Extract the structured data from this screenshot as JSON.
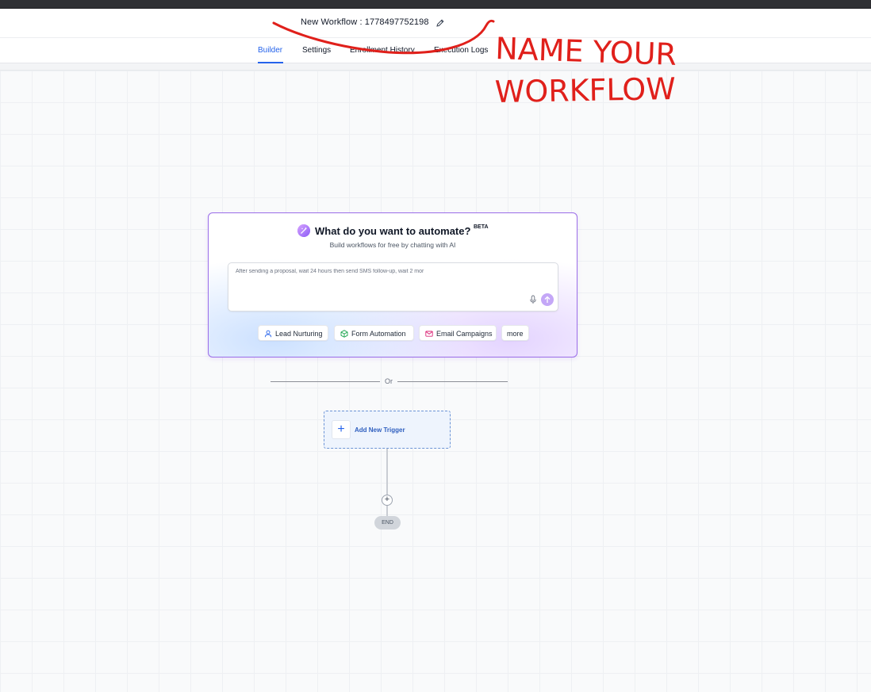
{
  "header": {
    "workflow_title": "New Workflow : 1778497752198"
  },
  "tabs": [
    {
      "label": "Builder",
      "active": true
    },
    {
      "label": "Settings",
      "active": false
    },
    {
      "label": "Enrollment History",
      "active": false
    },
    {
      "label": "Execution Logs",
      "active": false
    }
  ],
  "ai_card": {
    "title": "What do you want to automate?",
    "badge": "BETA",
    "subtitle": "Build workflows for free by chatting with AI",
    "prompt_value": "After sending a proposal, wait 24 hours then send SMS follow-up, wait 2 mor",
    "chips": [
      {
        "label": "Lead Nurturing",
        "icon": "user-icon"
      },
      {
        "label": "Form Automation",
        "icon": "cube-icon"
      },
      {
        "label": "Email Campaigns",
        "icon": "mail-icon"
      },
      {
        "label": "more",
        "icon": ""
      }
    ]
  },
  "divider": {
    "label": "Or"
  },
  "trigger": {
    "plus": "+",
    "label": "Add New Trigger"
  },
  "flow": {
    "add_step": "+",
    "end_label": "END"
  },
  "annotation": {
    "line1": "NAME YOUR",
    "line2": "WORKFLOW",
    "color": "#e0201b"
  },
  "colors": {
    "accent": "#2563eb",
    "ai_border": "#9b6de8"
  }
}
